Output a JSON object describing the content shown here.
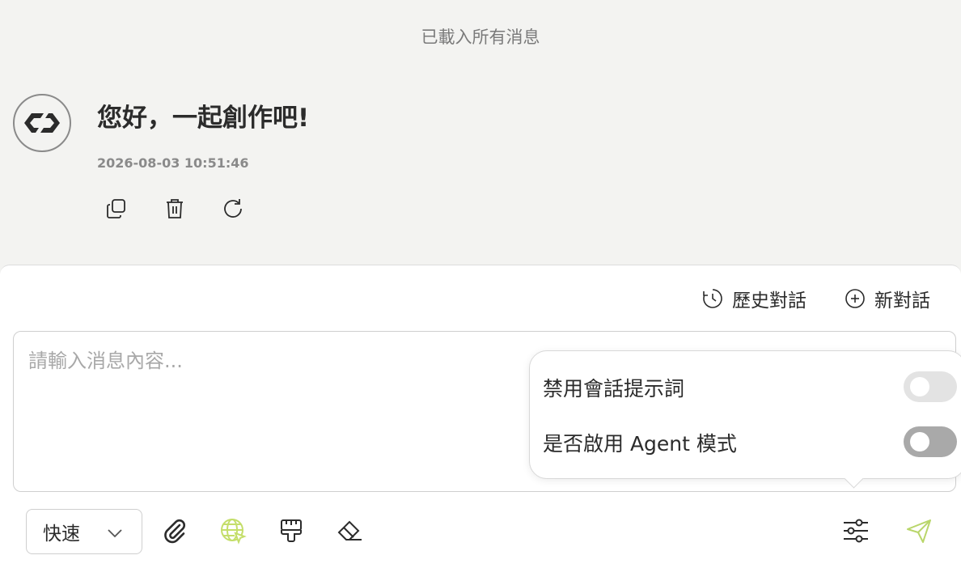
{
  "chat": {
    "loaded_note": "已載入所有消息",
    "message": {
      "text": "您好，一起創作吧!",
      "timestamp": "2026-08-03 10:51:46",
      "actions": [
        "copy-icon",
        "trash-icon",
        "refresh-icon"
      ]
    }
  },
  "composer": {
    "history_label": "歷史對話",
    "new_label": "新對話",
    "input_placeholder": "請輸入消息內容...",
    "input_value": "",
    "settings_popover": {
      "disable_prompt_label": "禁用會話提示詞",
      "disable_prompt_on": false,
      "agent_mode_label": "是否啟用 Agent 模式",
      "agent_mode_on": false
    },
    "mode_select_value": "快速",
    "tools": [
      "paperclip-icon",
      "globe-icon",
      "paint-brush-icon",
      "eraser-icon",
      "sliders-icon",
      "send-icon"
    ],
    "colors": {
      "accent_green": "#c4de6a",
      "send_icon": "#b9d66a",
      "toggle_off_light": "#e3e3e3",
      "toggle_off_dark": "#a9a9a9"
    }
  }
}
